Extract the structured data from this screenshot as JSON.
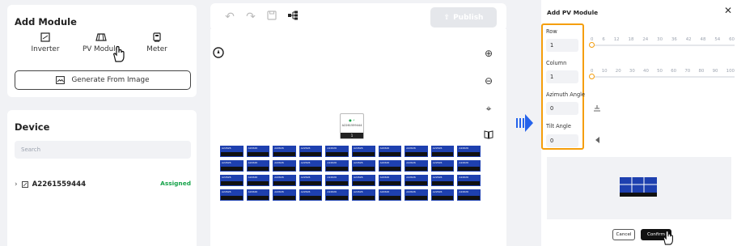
{
  "add_module": {
    "title": "Add Module",
    "modules": [
      {
        "label": "Inverter",
        "icon": "inverter-icon"
      },
      {
        "label": "PV Module",
        "icon": "pv-module-icon"
      },
      {
        "label": "Meter",
        "icon": "meter-icon"
      }
    ],
    "generate_label": "Generate From Image"
  },
  "device": {
    "title": "Device",
    "search_placeholder": "Search",
    "items": [
      {
        "name": "A2261559444",
        "status": "Assigned"
      }
    ]
  },
  "toolbar": {
    "publish_label": "Publish"
  },
  "canvas": {
    "device_label": "A2261559444",
    "device_count": "1",
    "panel_serial_prefix": "A22626",
    "rows": 4,
    "cols": 10
  },
  "modal": {
    "title": "Add PV Module",
    "row": {
      "label": "Row",
      "value": "1",
      "ticks": [
        "0",
        "6",
        "12",
        "18",
        "24",
        "30",
        "36",
        "42",
        "48",
        "54",
        "60"
      ]
    },
    "column": {
      "label": "Column",
      "value": "1",
      "ticks": [
        "0",
        "10",
        "20",
        "30",
        "40",
        "50",
        "60",
        "70",
        "80",
        "90",
        "100"
      ]
    },
    "azimuth": {
      "label": "Azimuth Angle",
      "value": "0"
    },
    "tilt": {
      "label": "Tilt Angle",
      "value": "0"
    },
    "cancel_label": "Cancel",
    "confirm_label": "Confirm"
  },
  "colors": {
    "accent": "#f59e0b",
    "panel": "#1e40af",
    "assigned": "#16a34a",
    "arrow": "#2563eb"
  }
}
